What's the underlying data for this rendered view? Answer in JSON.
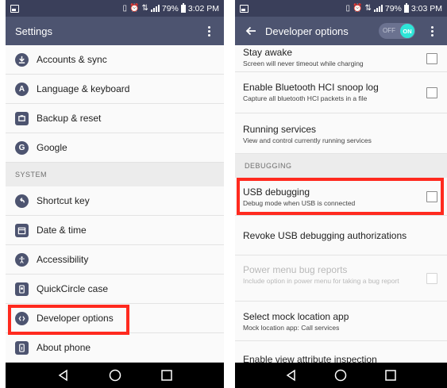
{
  "status_bar": {
    "left": {
      "battery": "79%",
      "time": "3:02 PM"
    },
    "right": {
      "battery": "79%",
      "time": "3:03 PM"
    }
  },
  "left_screen": {
    "title": "Settings",
    "items_top": [
      {
        "label": "Accounts & sync",
        "icon": "download-icon"
      },
      {
        "label": "Language & keyboard",
        "icon": "language-icon"
      },
      {
        "label": "Backup & reset",
        "icon": "backup-icon"
      },
      {
        "label": "Google",
        "icon": "google-icon"
      }
    ],
    "section": "SYSTEM",
    "items_system": [
      {
        "label": "Shortcut key",
        "icon": "shortcut-icon"
      },
      {
        "label": "Date & time",
        "icon": "calendar-icon"
      },
      {
        "label": "Accessibility",
        "icon": "accessibility-icon"
      },
      {
        "label": "QuickCircle case",
        "icon": "quickcircle-icon"
      },
      {
        "label": "Developer options",
        "icon": "developer-icon"
      },
      {
        "label": "About phone",
        "icon": "about-phone-icon"
      }
    ]
  },
  "right_screen": {
    "title": "Developer options",
    "toggle": {
      "off_label": "OFF",
      "on_label": "ON",
      "state": "on"
    },
    "items": [
      {
        "title": "Stay awake",
        "summary": "Screen will never timeout while charging",
        "checkbox": true,
        "disabled": false
      },
      {
        "title": "Enable Bluetooth HCI snoop log",
        "summary": "Capture all bluetooth HCI packets in a file",
        "checkbox": true,
        "disabled": false
      },
      {
        "title": "Running services",
        "summary": "View and control currently running services",
        "checkbox": false,
        "disabled": false
      }
    ],
    "section": "DEBUGGING",
    "debug_items": [
      {
        "title": "USB debugging",
        "summary": "Debug mode when USB is connected",
        "checkbox": true,
        "disabled": false
      },
      {
        "title": "Revoke USB debugging authorizations",
        "summary": "",
        "checkbox": false,
        "disabled": false
      },
      {
        "title": "Power menu bug reports",
        "summary": "Include option in power menu for taking a bug report",
        "checkbox": true,
        "disabled": true
      },
      {
        "title": "Select mock location app",
        "summary": "Mock location app: Call services",
        "checkbox": false,
        "disabled": false
      },
      {
        "title": "Enable view attribute inspection",
        "summary": "",
        "checkbox": true,
        "disabled": false
      }
    ]
  },
  "highlight_color": "#ff2a1f",
  "accent_color": "#2ee6d8"
}
